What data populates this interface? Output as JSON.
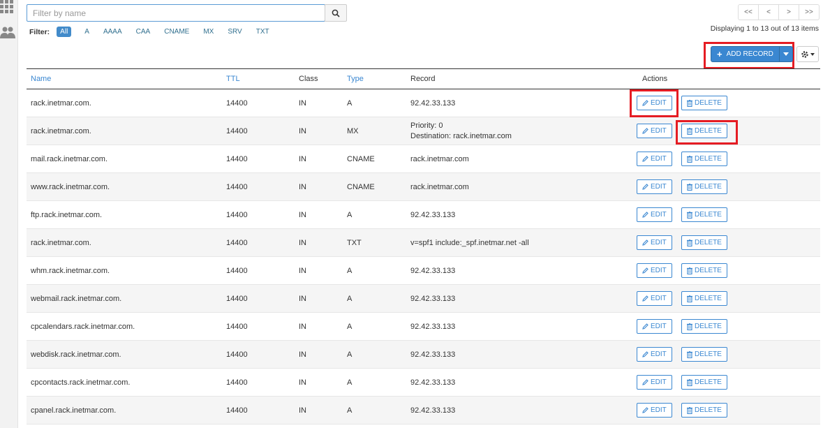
{
  "search": {
    "placeholder": "Filter by name",
    "value": ""
  },
  "filter": {
    "label": "Filter:",
    "options": [
      "All",
      "A",
      "AAAA",
      "CAA",
      "CNAME",
      "MX",
      "SRV",
      "TXT"
    ],
    "active": "All"
  },
  "pager": {
    "first": "<<",
    "prev": "<",
    "next": ">",
    "last": ">>"
  },
  "display_info": "Displaying 1 to 13 out of 13 items",
  "toolbar": {
    "add_record_label": "ADD RECORD"
  },
  "table": {
    "headers": {
      "name": "Name",
      "ttl": "TTL",
      "class": "Class",
      "type": "Type",
      "record": "Record",
      "actions": "Actions"
    },
    "edit_label": "EDIT",
    "delete_label": "DELETE",
    "rows": [
      {
        "name": "rack.inetmar.com.",
        "ttl": "14400",
        "class": "IN",
        "type": "A",
        "record": "92.42.33.133"
      },
      {
        "name": "rack.inetmar.com.",
        "ttl": "14400",
        "class": "IN",
        "type": "MX",
        "record_lines": [
          "Priority: 0",
          "Destination: rack.inetmar.com"
        ]
      },
      {
        "name": "mail.rack.inetmar.com.",
        "ttl": "14400",
        "class": "IN",
        "type": "CNAME",
        "record": "rack.inetmar.com"
      },
      {
        "name": "www.rack.inetmar.com.",
        "ttl": "14400",
        "class": "IN",
        "type": "CNAME",
        "record": "rack.inetmar.com"
      },
      {
        "name": "ftp.rack.inetmar.com.",
        "ttl": "14400",
        "class": "IN",
        "type": "A",
        "record": "92.42.33.133"
      },
      {
        "name": "rack.inetmar.com.",
        "ttl": "14400",
        "class": "IN",
        "type": "TXT",
        "record": "v=spf1 include:_spf.inetmar.net -all"
      },
      {
        "name": "whm.rack.inetmar.com.",
        "ttl": "14400",
        "class": "IN",
        "type": "A",
        "record": "92.42.33.133"
      },
      {
        "name": "webmail.rack.inetmar.com.",
        "ttl": "14400",
        "class": "IN",
        "type": "A",
        "record": "92.42.33.133"
      },
      {
        "name": "cpcalendars.rack.inetmar.com.",
        "ttl": "14400",
        "class": "IN",
        "type": "A",
        "record": "92.42.33.133"
      },
      {
        "name": "webdisk.rack.inetmar.com.",
        "ttl": "14400",
        "class": "IN",
        "type": "A",
        "record": "92.42.33.133"
      },
      {
        "name": "cpcontacts.rack.inetmar.com.",
        "ttl": "14400",
        "class": "IN",
        "type": "A",
        "record": "92.42.33.133"
      },
      {
        "name": "cpanel.rack.inetmar.com.",
        "ttl": "14400",
        "class": "IN",
        "type": "A",
        "record": "92.42.33.133"
      }
    ]
  },
  "colors": {
    "accent": "#3a87d1",
    "highlight": "#e51c23",
    "active_filter": "#428bca"
  },
  "icons": {
    "rail": [
      "grid-apps-icon",
      "users-icon"
    ],
    "search": "magnifier-icon",
    "add": "plus-icon",
    "edit": "pencil-icon",
    "delete": "trash-icon",
    "settings": "gear-icon"
  }
}
